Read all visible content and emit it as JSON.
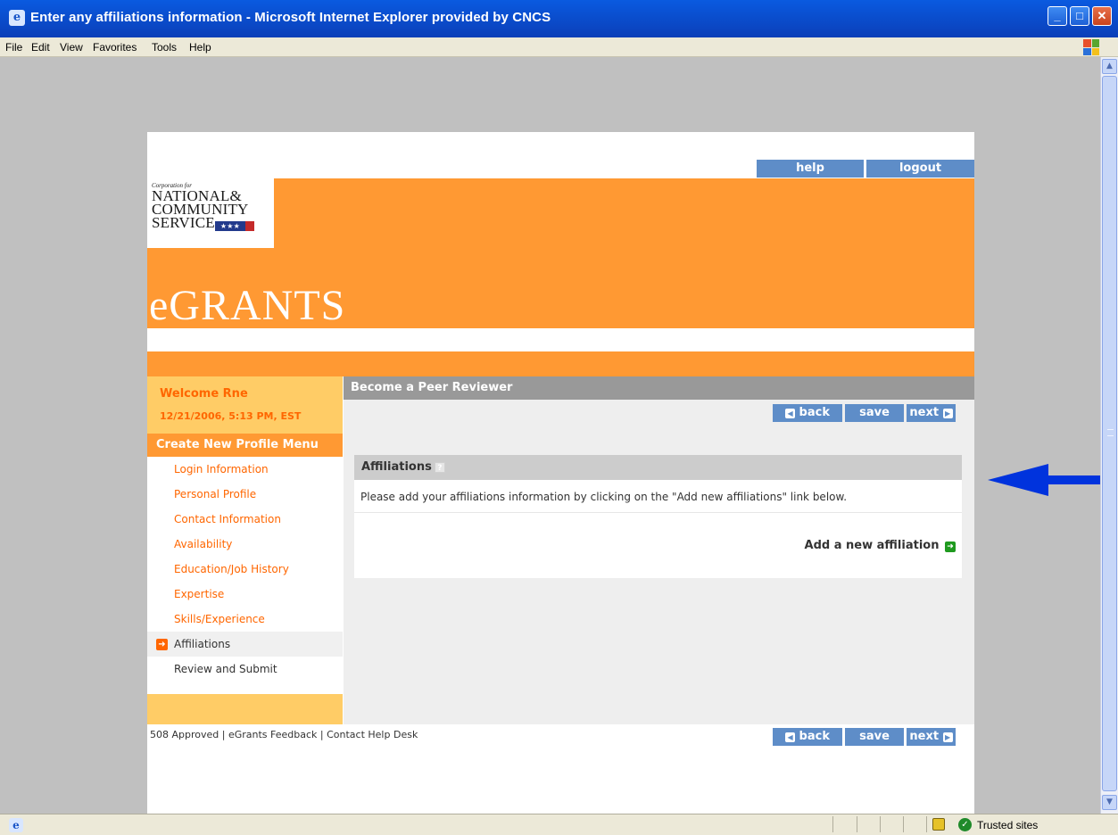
{
  "window": {
    "title": "Enter any affiliations information - Microsoft Internet Explorer provided by CNCS",
    "controls": [
      "minimize",
      "maximize",
      "close"
    ]
  },
  "menubar": [
    "File",
    "Edit",
    "View",
    "Favorites",
    "Tools",
    "Help"
  ],
  "statusbar": {
    "zone": "Trusted sites"
  },
  "header": {
    "nav": [
      "help",
      "logout"
    ],
    "logo": {
      "corp": "Corporation for",
      "line1": "NATIONAL&",
      "line2": "COMMUNITY",
      "line3": "SERVICE"
    },
    "brand": "eGRANTS"
  },
  "sidebar": {
    "welcome": "Welcome Rne",
    "datetime": "12/21/2006, 5:13 PM, EST",
    "menu_title": "Create New Profile Menu",
    "items": [
      "Login Information",
      "Personal Profile",
      "Contact Information",
      "Availability",
      "Education/Job History",
      "Expertise",
      "Skills/Experience",
      "Affiliations",
      "Review and Submit"
    ],
    "active_item": "Affiliations"
  },
  "main": {
    "header": "Become a Peer Reviewer",
    "buttons": [
      "back",
      "save",
      "next"
    ],
    "panel": {
      "title": "Affiliations",
      "instruction": "Please add your affiliations information by clicking on the \"Add new affiliations\" link below.",
      "add_link": "Add a new affiliation"
    }
  },
  "footer": {
    "links": "508 Approved | eGrants Feedback | Contact Help Desk"
  },
  "colors": {
    "banner": "#ff9933",
    "welcome_bg": "#ffcc66",
    "button": "#5e8dc8",
    "annotation_arrow": "#0033dd"
  }
}
